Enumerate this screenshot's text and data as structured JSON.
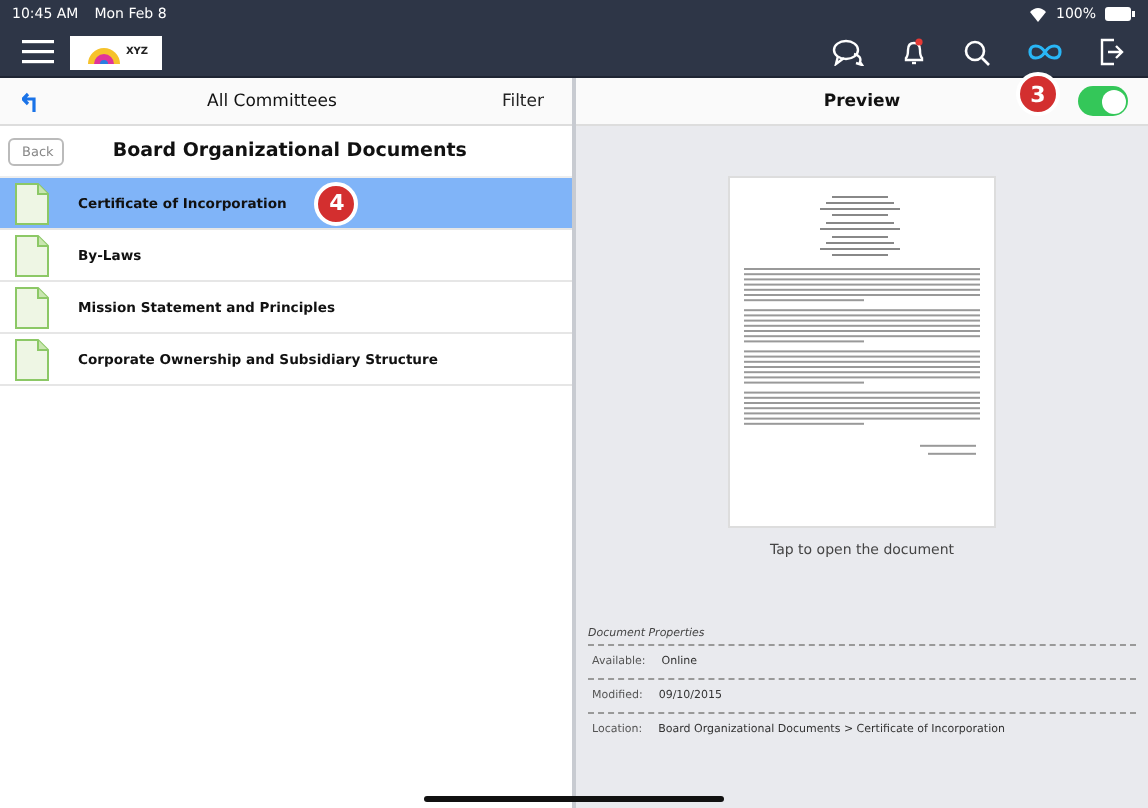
{
  "status_bar": {
    "time": "10:45 AM",
    "date": "Mon Feb 8",
    "battery": "100%"
  },
  "nav_bar": {
    "logo": "XYZ"
  },
  "left_panel": {
    "header": {
      "title": "All Committees",
      "action": "Filter"
    },
    "back": "Back",
    "title": "Board Organizational Documents",
    "documents": [
      {
        "name": "Certificate of Incorporation",
        "selected": true,
        "badge": "4"
      },
      {
        "name": "By-Laws",
        "selected": false
      },
      {
        "name": "Mission Statement and Principles",
        "selected": false
      },
      {
        "name": "Corporate Ownership and Subsidiary Structure",
        "selected": false
      }
    ]
  },
  "right_panel": {
    "title": "Preview",
    "badge": "3",
    "toggle": {
      "on": true
    },
    "hint": "Tap to open the document",
    "properties": {
      "heading": "Document Properties",
      "rows": [
        {
          "label": "Available:",
          "value": "Online"
        },
        {
          "label": "Modified:",
          "value": "09/10/2015"
        },
        {
          "label": "Location:",
          "value": "Board Organizational Documents > Certificate of Incorporation"
        }
      ]
    }
  }
}
